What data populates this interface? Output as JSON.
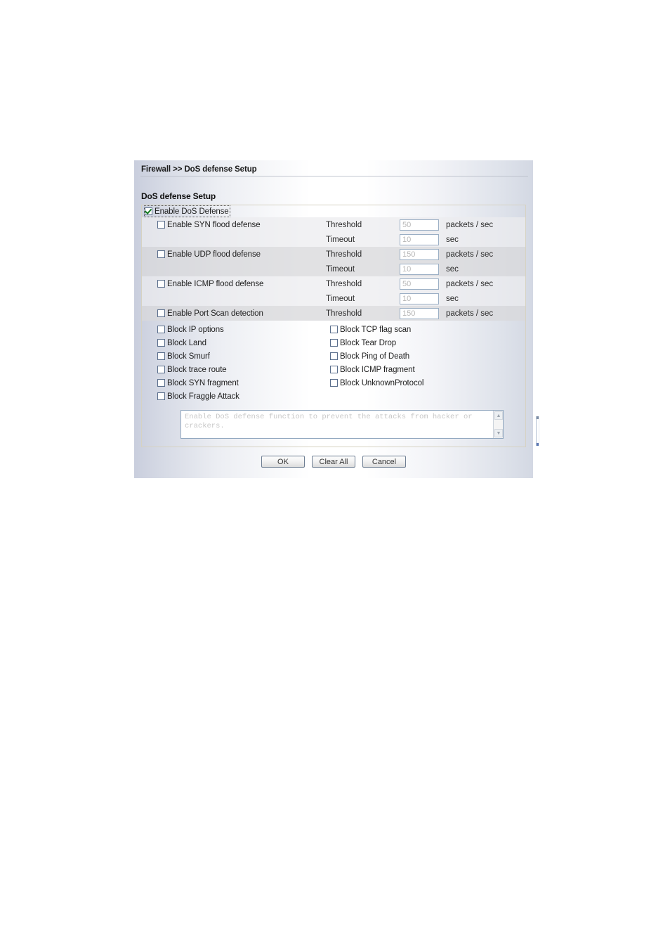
{
  "breadcrumb": "Firewall >> DoS defense Setup",
  "section_title": "DoS defense Setup",
  "master": {
    "label": "Enable DoS Defense",
    "checked": true
  },
  "flood_rows": [
    {
      "label": "Enable SYN flood defense",
      "checked": false,
      "threshold_label": "Threshold",
      "threshold_value": "50",
      "threshold_unit": "packets / sec",
      "timeout_label": "Timeout",
      "timeout_value": "10",
      "timeout_unit": "sec"
    },
    {
      "label": "Enable UDP flood defense",
      "checked": false,
      "threshold_label": "Threshold",
      "threshold_value": "150",
      "threshold_unit": "packets / sec",
      "timeout_label": "Timeout",
      "timeout_value": "10",
      "timeout_unit": "sec"
    },
    {
      "label": "Enable ICMP flood defense",
      "checked": false,
      "threshold_label": "Threshold",
      "threshold_value": "50",
      "threshold_unit": "packets / sec",
      "timeout_label": "Timeout",
      "timeout_value": "10",
      "timeout_unit": "sec"
    }
  ],
  "portscan_row": {
    "label": "Enable Port Scan detection",
    "checked": false,
    "threshold_label": "Threshold",
    "threshold_value": "150",
    "threshold_unit": "packets / sec"
  },
  "block_rows": [
    {
      "left": "Block IP options",
      "left_checked": false,
      "right": "Block TCP flag scan",
      "right_checked": false
    },
    {
      "left": "Block Land",
      "left_checked": false,
      "right": "Block Tear Drop",
      "right_checked": false
    },
    {
      "left": "Block Smurf",
      "left_checked": false,
      "right": "Block Ping of Death",
      "right_checked": false
    },
    {
      "left": "Block trace route",
      "left_checked": false,
      "right": "Block ICMP fragment",
      "right_checked": false
    },
    {
      "left": "Block SYN fragment",
      "left_checked": false,
      "right": "Block UnknownProtocol",
      "right_checked": false
    },
    {
      "left": "Block Fraggle Attack",
      "left_checked": false,
      "right": "",
      "right_checked": false
    }
  ],
  "note": "Enable DoS defense function to prevent the attacks from hacker or crackers.",
  "buttons": {
    "ok": "OK",
    "clear_all": "Clear All",
    "cancel": "Cancel"
  },
  "colors": {
    "check_green": "#137a21",
    "checkbox_border": "#5a6e8c",
    "input_border": "#9aaec4",
    "panel_border": "#d6d2c2"
  }
}
